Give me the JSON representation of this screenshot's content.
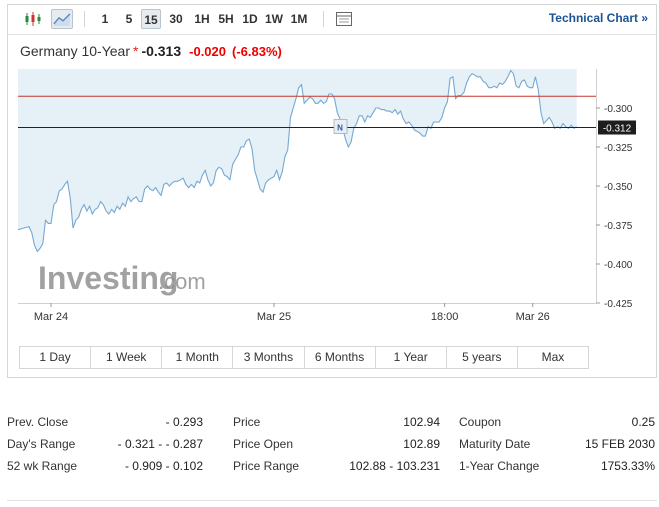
{
  "toolbar": {
    "timeframes": [
      "1",
      "5",
      "15",
      "30",
      "1H",
      "5H",
      "1D",
      "1W",
      "1M"
    ],
    "active_timeframe": "15",
    "technical_chart_label": "Technical Chart »"
  },
  "instrument": {
    "name": "Germany 10-Year",
    "star": "*",
    "last": "-0.313",
    "change": "-0.020",
    "change_pct": "(-6.83%)",
    "colors": {
      "down": "#e00000",
      "link": "#1a5494"
    }
  },
  "chart_data": {
    "type": "area",
    "title": "",
    "xlabel": "",
    "ylabel": "",
    "ylim": [
      -0.425,
      -0.275
    ],
    "y_ticks": [
      "-0.300",
      "-0.325",
      "-0.350",
      "-0.375",
      "-0.400",
      "-0.425"
    ],
    "y_tick_values": [
      -0.3,
      -0.325,
      -0.35,
      -0.375,
      -0.4,
      -0.425
    ],
    "x_ticks": [
      "Mar 24",
      "Mar 25",
      "18:00",
      "Mar 26"
    ],
    "x_tick_positions": [
      12,
      93,
      155,
      187
    ],
    "xlim": [
      0,
      210
    ],
    "current_value_label": "-0.312",
    "current_value": -0.3125,
    "reference_value": -0.2925,
    "marker_label": "N",
    "marker_x": 117,
    "watermark": "Investing",
    "watermark_suffix": ".com",
    "series": [
      {
        "values": [
          [
            0,
            -0.378
          ],
          [
            2,
            -0.377
          ],
          [
            4,
            -0.376
          ],
          [
            5,
            -0.38
          ],
          [
            6,
            -0.388
          ],
          [
            7,
            -0.392
          ],
          [
            8,
            -0.39
          ],
          [
            9,
            -0.387
          ],
          [
            10,
            -0.372
          ],
          [
            11,
            -0.374
          ],
          [
            12,
            -0.374
          ],
          [
            13,
            -0.362
          ],
          [
            14,
            -0.36
          ],
          [
            15,
            -0.353
          ],
          [
            16,
            -0.352
          ],
          [
            17,
            -0.349
          ],
          [
            18,
            -0.347
          ],
          [
            19,
            -0.358
          ],
          [
            20,
            -0.377
          ],
          [
            21,
            -0.372
          ],
          [
            22,
            -0.37
          ],
          [
            23,
            -0.365
          ],
          [
            24,
            -0.362
          ],
          [
            25,
            -0.366
          ],
          [
            26,
            -0.363
          ],
          [
            27,
            -0.368
          ],
          [
            28,
            -0.365
          ],
          [
            29,
            -0.364
          ],
          [
            30,
            -0.36
          ],
          [
            31,
            -0.362
          ],
          [
            32,
            -0.366
          ],
          [
            33,
            -0.368
          ],
          [
            34,
            -0.365
          ],
          [
            35,
            -0.367
          ],
          [
            36,
            -0.363
          ],
          [
            37,
            -0.365
          ],
          [
            38,
            -0.361
          ],
          [
            39,
            -0.363
          ],
          [
            40,
            -0.357
          ],
          [
            41,
            -0.36
          ],
          [
            42,
            -0.358
          ],
          [
            43,
            -0.357
          ],
          [
            44,
            -0.36
          ],
          [
            45,
            -0.36
          ],
          [
            46,
            -0.352
          ],
          [
            47,
            -0.35
          ],
          [
            48,
            -0.352
          ],
          [
            49,
            -0.353
          ],
          [
            50,
            -0.351
          ],
          [
            51,
            -0.354
          ],
          [
            52,
            -0.356
          ],
          [
            53,
            -0.349
          ],
          [
            54,
            -0.348
          ],
          [
            55,
            -0.35
          ],
          [
            56,
            -0.348
          ],
          [
            57,
            -0.347
          ],
          [
            58,
            -0.347
          ],
          [
            59,
            -0.346
          ],
          [
            60,
            -0.345
          ],
          [
            61,
            -0.349
          ],
          [
            62,
            -0.351
          ],
          [
            63,
            -0.349
          ],
          [
            64,
            -0.351
          ],
          [
            65,
            -0.347
          ],
          [
            66,
            -0.348
          ],
          [
            67,
            -0.343
          ],
          [
            68,
            -0.34
          ],
          [
            69,
            -0.346
          ],
          [
            70,
            -0.35
          ],
          [
            71,
            -0.348
          ],
          [
            72,
            -0.34
          ],
          [
            73,
            -0.338
          ],
          [
            74,
            -0.339
          ],
          [
            75,
            -0.343
          ],
          [
            76,
            -0.344
          ],
          [
            77,
            -0.346
          ],
          [
            78,
            -0.336
          ],
          [
            79,
            -0.333
          ],
          [
            80,
            -0.33
          ],
          [
            81,
            -0.325
          ],
          [
            82,
            -0.325
          ],
          [
            83,
            -0.321
          ],
          [
            84,
            -0.32
          ],
          [
            85,
            -0.326
          ],
          [
            86,
            -0.34
          ],
          [
            87,
            -0.346
          ],
          [
            88,
            -0.352
          ],
          [
            89,
            -0.354
          ],
          [
            90,
            -0.348
          ],
          [
            91,
            -0.346
          ],
          [
            92,
            -0.345
          ],
          [
            93,
            -0.344
          ],
          [
            94,
            -0.34
          ],
          [
            95,
            -0.346
          ],
          [
            96,
            -0.341
          ],
          [
            97,
            -0.331
          ],
          [
            98,
            -0.327
          ],
          [
            99,
            -0.306
          ],
          [
            100,
            -0.3
          ],
          [
            101,
            -0.294
          ],
          [
            102,
            -0.287
          ],
          [
            103,
            -0.285
          ],
          [
            104,
            -0.297
          ],
          [
            105,
            -0.295
          ],
          [
            106,
            -0.293
          ],
          [
            107,
            -0.294
          ],
          [
            108,
            -0.297
          ],
          [
            109,
            -0.297
          ],
          [
            110,
            -0.295
          ],
          [
            111,
            -0.297
          ],
          [
            112,
            -0.296
          ],
          [
            113,
            -0.291
          ],
          [
            114,
            -0.291
          ],
          [
            115,
            -0.294
          ],
          [
            116,
            -0.303
          ],
          [
            117,
            -0.307
          ],
          [
            118,
            -0.313
          ],
          [
            119,
            -0.32
          ],
          [
            120,
            -0.325
          ],
          [
            121,
            -0.322
          ],
          [
            122,
            -0.313
          ],
          [
            123,
            -0.31
          ],
          [
            124,
            -0.305
          ],
          [
            125,
            -0.305
          ],
          [
            126,
            -0.309
          ],
          [
            127,
            -0.305
          ],
          [
            128,
            -0.306
          ],
          [
            129,
            -0.303
          ],
          [
            130,
            -0.3
          ],
          [
            131,
            -0.3
          ],
          [
            132,
            -0.301
          ],
          [
            133,
            -0.301
          ],
          [
            134,
            -0.302
          ],
          [
            135,
            -0.302
          ],
          [
            136,
            -0.303
          ],
          [
            137,
            -0.301
          ],
          [
            138,
            -0.304
          ],
          [
            139,
            -0.302
          ],
          [
            140,
            -0.307
          ],
          [
            141,
            -0.31
          ],
          [
            142,
            -0.309
          ],
          [
            143,
            -0.311
          ],
          [
            144,
            -0.314
          ],
          [
            145,
            -0.315
          ],
          [
            146,
            -0.316
          ],
          [
            147,
            -0.318
          ],
          [
            148,
            -0.318
          ],
          [
            149,
            -0.312
          ],
          [
            150,
            -0.313
          ],
          [
            151,
            -0.309
          ],
          [
            152,
            -0.309
          ],
          [
            153,
            -0.309
          ],
          [
            154,
            -0.306
          ],
          [
            155,
            -0.3
          ],
          [
            156,
            -0.296
          ],
          [
            157,
            -0.281
          ],
          [
            158,
            -0.28
          ],
          [
            159,
            -0.294
          ],
          [
            160,
            -0.292
          ],
          [
            161,
            -0.292
          ],
          [
            162,
            -0.29
          ],
          [
            163,
            -0.284
          ],
          [
            164,
            -0.28
          ],
          [
            165,
            -0.278
          ],
          [
            166,
            -0.279
          ],
          [
            167,
            -0.28
          ],
          [
            168,
            -0.28
          ],
          [
            169,
            -0.283
          ],
          [
            170,
            -0.284
          ],
          [
            171,
            -0.287
          ],
          [
            172,
            -0.287
          ],
          [
            173,
            -0.286
          ],
          [
            174,
            -0.287
          ],
          [
            175,
            -0.284
          ],
          [
            176,
            -0.285
          ],
          [
            177,
            -0.283
          ],
          [
            178,
            -0.28
          ],
          [
            179,
            -0.276
          ],
          [
            180,
            -0.278
          ],
          [
            181,
            -0.286
          ],
          [
            182,
            -0.287
          ],
          [
            183,
            -0.283
          ],
          [
            184,
            -0.282
          ],
          [
            185,
            -0.286
          ],
          [
            186,
            -0.287
          ],
          [
            187,
            -0.287
          ],
          [
            188,
            -0.28
          ],
          [
            189,
            -0.288
          ],
          [
            190,
            -0.303
          ],
          [
            191,
            -0.31
          ],
          [
            192,
            -0.308
          ],
          [
            193,
            -0.306
          ],
          [
            194,
            -0.309
          ],
          [
            195,
            -0.313
          ],
          [
            196,
            -0.312
          ],
          [
            197,
            -0.313
          ],
          [
            198,
            -0.31
          ],
          [
            199,
            -0.312
          ],
          [
            200,
            -0.313
          ],
          [
            201,
            -0.311
          ],
          [
            202,
            -0.313
          ],
          [
            203,
            -0.312
          ]
        ]
      }
    ]
  },
  "ranges": [
    "1 Day",
    "1 Week",
    "1 Month",
    "3 Months",
    "6 Months",
    "1 Year",
    "5 years",
    "Max"
  ],
  "stats": {
    "col1": [
      {
        "label": "Prev. Close",
        "value": "- 0.293"
      },
      {
        "label": "Day's Range",
        "value": "- 0.321 - - 0.287"
      },
      {
        "label": "52 wk Range",
        "value": "- 0.909 - 0.102"
      }
    ],
    "col2": [
      {
        "label": "Price",
        "value": "102.94"
      },
      {
        "label": "Price Open",
        "value": "102.89"
      },
      {
        "label": "Price Range",
        "value": "102.88 - 103.231"
      }
    ],
    "col3": [
      {
        "label": "Coupon",
        "value": "0.25"
      },
      {
        "label": "Maturity Date",
        "value": "15 FEB 2030"
      },
      {
        "label": "1-Year Change",
        "value": "1753.33%"
      }
    ]
  }
}
